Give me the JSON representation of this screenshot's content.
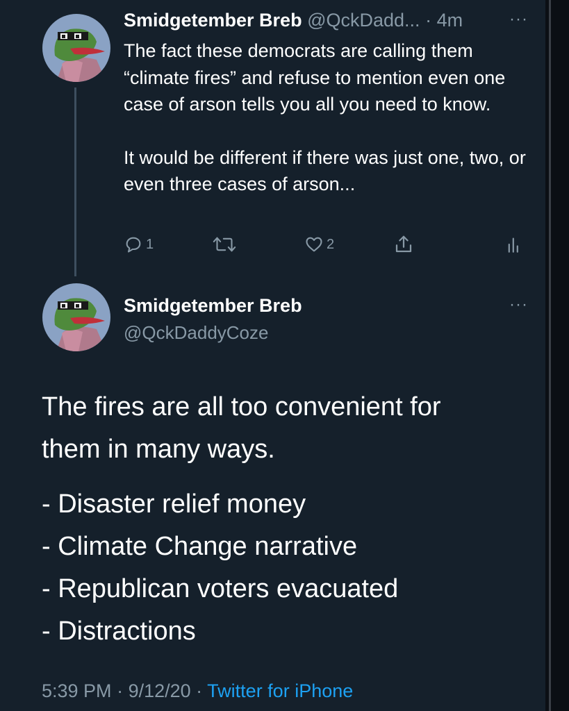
{
  "colors": {
    "background": "#15202b",
    "text": "#ffffff",
    "secondary_text": "#8899a6",
    "link": "#1da1f2",
    "thread_line": "#3d4f5f"
  },
  "reply_tweet": {
    "avatar_icon": "frog-avatar-icon",
    "name": "Smidgetember Breb",
    "handle": "@QckDadd...",
    "separator": " · ",
    "time": "4m",
    "more_icon": "more-dots-icon",
    "more_glyph": "···",
    "text_paragraphs": [
      "The fact these democrats are calling them “climate fires” and refuse to mention even one case of arson tells you all you need to know.",
      "It would be different if there was just one, two, or even three cases of arson..."
    ],
    "actions": {
      "reply": {
        "icon": "reply-icon",
        "count": "1"
      },
      "retweet": {
        "icon": "retweet-icon",
        "count": ""
      },
      "like": {
        "icon": "heart-icon",
        "count": "2"
      },
      "share": {
        "icon": "share-icon"
      },
      "analytics": {
        "icon": "analytics-icon"
      }
    }
  },
  "main_tweet": {
    "avatar_icon": "frog-avatar-icon",
    "name": "Smidgetember Breb",
    "handle": "@QckDaddyCoze",
    "more_icon": "more-dots-icon",
    "more_glyph": "···",
    "intro_lines": [
      "The fires are all too convenient for",
      "them in many ways."
    ],
    "list_items": [
      "- Disaster relief money",
      "- Climate Change narrative",
      "- Republican voters evacuated",
      "- Distractions"
    ],
    "time": "5:39 PM",
    "date": "9/12/20",
    "dot": " · ",
    "source": "Twitter for iPhone"
  }
}
